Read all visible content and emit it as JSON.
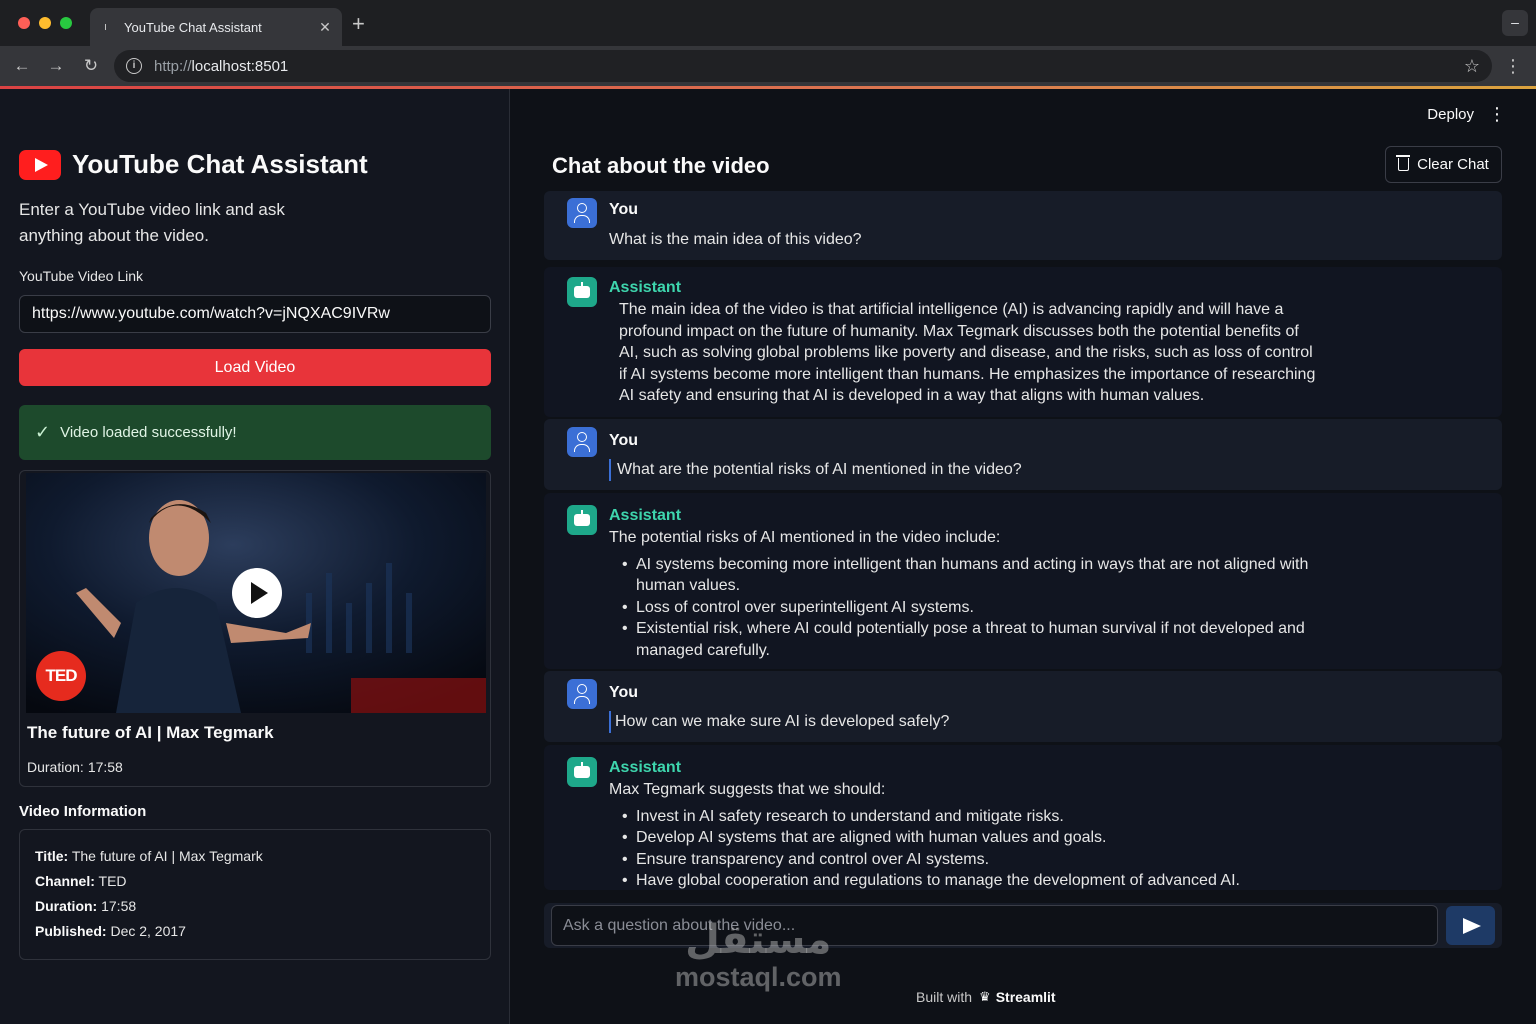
{
  "browser": {
    "tab_title": "YouTube Chat Assistant",
    "url_scheme": "http://",
    "url_host": "localhost:8501"
  },
  "sidebar": {
    "app_title": "YouTube Chat Assistant",
    "intro": "Enter a YouTube video link and ask anything about the video.",
    "link_label": "YouTube Video Link",
    "link_value": "https://www.youtube.com/watch?v=jNQXAC9IVRw",
    "load_button": "Load Video",
    "success_message": "Video loaded successfully!",
    "video": {
      "badge": "TED",
      "title": "The future of AI | Max Tegmark",
      "duration_label": "Duration:",
      "duration": "17:58"
    },
    "info_heading": "Video Information",
    "info": [
      {
        "label": "Title:",
        "value": "The future of AI | Max Tegmark"
      },
      {
        "label": "Channel:",
        "value": "TED"
      },
      {
        "label": "Duration:",
        "value": "17:58"
      },
      {
        "label": "Published:",
        "value": "Dec 2, 2017"
      }
    ]
  },
  "header": {
    "deploy": "Deploy"
  },
  "chat": {
    "title": "Chat about the video",
    "clear_button": "Clear Chat",
    "messages": [
      {
        "role": "You",
        "text": "What is the main idea of this video?"
      },
      {
        "role": "Assistant",
        "text": "The main idea of the video is that artificial intelligence (AI) is advancing rapidly and will have a profound impact on the future of humanity. Max Tegmark discusses both the potential benefits of AI, such as solving global problems like poverty and disease, and the risks, such as loss of control if AI systems become more intelligent than humans. He emphasizes the importance of researching AI safety and ensuring that AI is developed in a way that aligns with human values."
      },
      {
        "role": "You",
        "text": "What are the potential risks of AI mentioned in the video?"
      },
      {
        "role": "Assistant",
        "text": "The potential risks of AI mentioned in the video include:",
        "bullets": [
          "AI systems becoming more intelligent than humans and acting in ways that are not aligned with human values.",
          "Loss of control over superintelligent AI systems.",
          "Existential risk, where AI could potentially pose a threat to human survival if not developed and managed carefully."
        ]
      },
      {
        "role": "You",
        "text": "How can we make sure AI is developed safely?"
      },
      {
        "role": "Assistant",
        "text": "Max Tegmark suggests that we should:",
        "bullets": [
          "Invest in AI safety research to understand and mitigate risks.",
          "Develop AI systems that are aligned with human values and goals.",
          "Ensure transparency and control over AI systems.",
          "Have global cooperation and regulations to manage the development of advanced AI."
        ]
      }
    ],
    "input_placeholder": "Ask a question about the video..."
  },
  "footer": {
    "prefix": "Built with",
    "brand": "Streamlit"
  },
  "watermark": {
    "arabic": "مستقل",
    "latin": "mostaql.com"
  },
  "colors": {
    "accent_red": "#e8343a",
    "assistant_green": "#3ed5ad",
    "user_blue": "#3b6fd6",
    "success_bg": "#1d4a2c"
  }
}
